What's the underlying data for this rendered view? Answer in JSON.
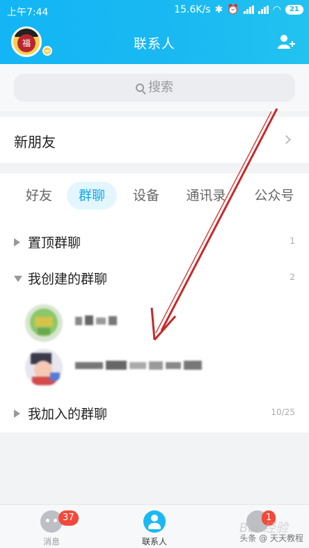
{
  "statusbar": {
    "time": "上午7:44",
    "speed": "15.6K/s",
    "battery": "21"
  },
  "header": {
    "title": "联系人"
  },
  "search": {
    "placeholder": "搜索"
  },
  "new_friends": {
    "label": "新朋友"
  },
  "tabs": [
    {
      "label": "好友"
    },
    {
      "label": "群聊"
    },
    {
      "label": "设备"
    },
    {
      "label": "通讯录"
    },
    {
      "label": "公众号"
    }
  ],
  "groups": {
    "pinned": {
      "name": "置顶群聊",
      "count": "1"
    },
    "created": {
      "name": "我创建的群聊",
      "count": "2"
    },
    "joined": {
      "name": "我加入的群聊",
      "count": "10/25"
    }
  },
  "bottom_nav": {
    "messages": {
      "label": "消息",
      "badge": "37"
    },
    "contacts": {
      "label": "联系人"
    },
    "dynamic": {
      "badge": "1"
    }
  },
  "colors": {
    "accent": "#12a8e6",
    "header": "#1ab9f2",
    "badge": "#f4483a",
    "arrow": "#c62828"
  },
  "watermark": "头条 @ 天天教程",
  "watermark2": "Bai 经验"
}
